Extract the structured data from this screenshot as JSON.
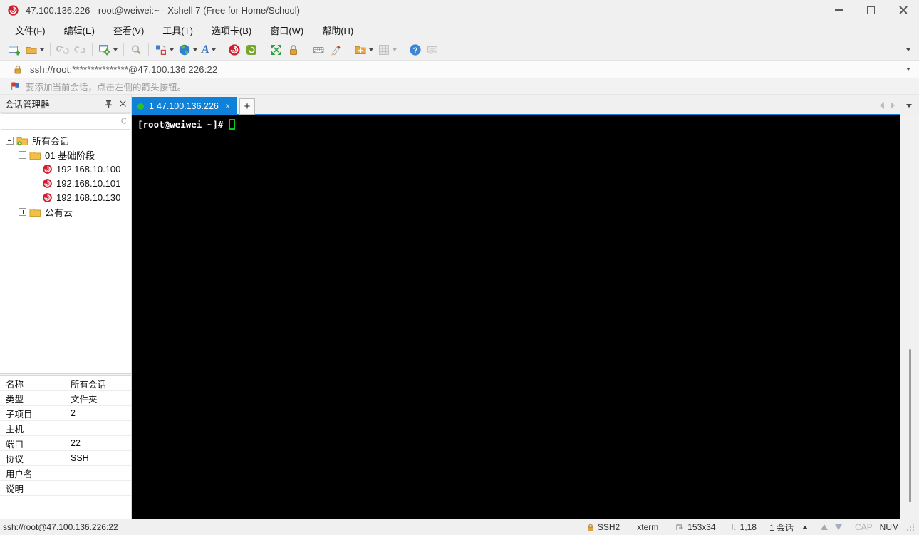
{
  "colors": {
    "tab_active_blue": "#1081d8",
    "connected_dot_green": "#2bbf2b",
    "terminal_background": "#000000",
    "terminal_text": "#ffffff",
    "cursor_green": "#00ce1b",
    "session_icon_red": "#cf2030",
    "folder_yellow": "#f3bf4a"
  },
  "window": {
    "title": "47.100.136.226 - root@weiwei:~ - Xshell 7 (Free for Home/School)"
  },
  "menu": {
    "items": [
      {
        "label": "文件(F)"
      },
      {
        "label": "编辑(E)"
      },
      {
        "label": "查看(V)"
      },
      {
        "label": "工具(T)"
      },
      {
        "label": "选项卡(B)"
      },
      {
        "label": "窗口(W)"
      },
      {
        "label": "帮助(H)"
      }
    ]
  },
  "toolbar": {
    "icons": [
      "new-session",
      "open-sessions",
      "disconnect",
      "reconnect",
      "session-properties",
      "find",
      "tile-layout",
      "web-browser",
      "font",
      "xshell",
      "xftp",
      "fullscreen",
      "lock-screen",
      "virtual-keyboard",
      "highlight-pen",
      "new-session-folder",
      "compose-grid",
      "help",
      "feedback"
    ]
  },
  "address_bar": {
    "url": "ssh://root:***************@47.100.136.226:22"
  },
  "info_bar": {
    "text": "要添加当前会话，点击左侧的箭头按钮。"
  },
  "session_manager": {
    "title": "会话管理器",
    "search_placeholder": "",
    "tree": [
      {
        "label": "所有会话",
        "level": 0,
        "icon": "folder-all-sessions",
        "expander": "minus"
      },
      {
        "label": "01 基础阶段",
        "level": 1,
        "icon": "folder",
        "expander": "minus"
      },
      {
        "label": "192.168.10.100",
        "level": 2,
        "icon": "session"
      },
      {
        "label": "192.168.10.101",
        "level": 2,
        "icon": "session"
      },
      {
        "label": "192.168.10.130",
        "level": 2,
        "icon": "session"
      },
      {
        "label": "公有云",
        "level": 1,
        "icon": "folder",
        "expander": "plus"
      }
    ],
    "properties": {
      "rows": [
        {
          "label": "名称",
          "value": "所有会话"
        },
        {
          "label": "类型",
          "value": "文件夹"
        },
        {
          "label": "子项目",
          "value": "2"
        },
        {
          "label": "主机",
          "value": ""
        },
        {
          "label": "端口",
          "value": "22"
        },
        {
          "label": "协议",
          "value": "SSH"
        },
        {
          "label": "用户名",
          "value": ""
        },
        {
          "label": "说明",
          "value": ""
        }
      ]
    }
  },
  "tab_bar": {
    "active_tab": {
      "number": "1",
      "label": "47.100.136.226",
      "close": "×"
    },
    "new_tab_label": "+"
  },
  "terminal": {
    "prompt": "[root@weiwei ~]#"
  },
  "status_bar": {
    "session_url": "ssh://root@47.100.136.226:22",
    "protocol": "SSH2",
    "terminal_type": "xterm",
    "screen_size": "153x34",
    "cursor_position": "1,18",
    "session_count": "1 会话",
    "caps_indicator": "CAP",
    "num_indicator": "NUM"
  }
}
